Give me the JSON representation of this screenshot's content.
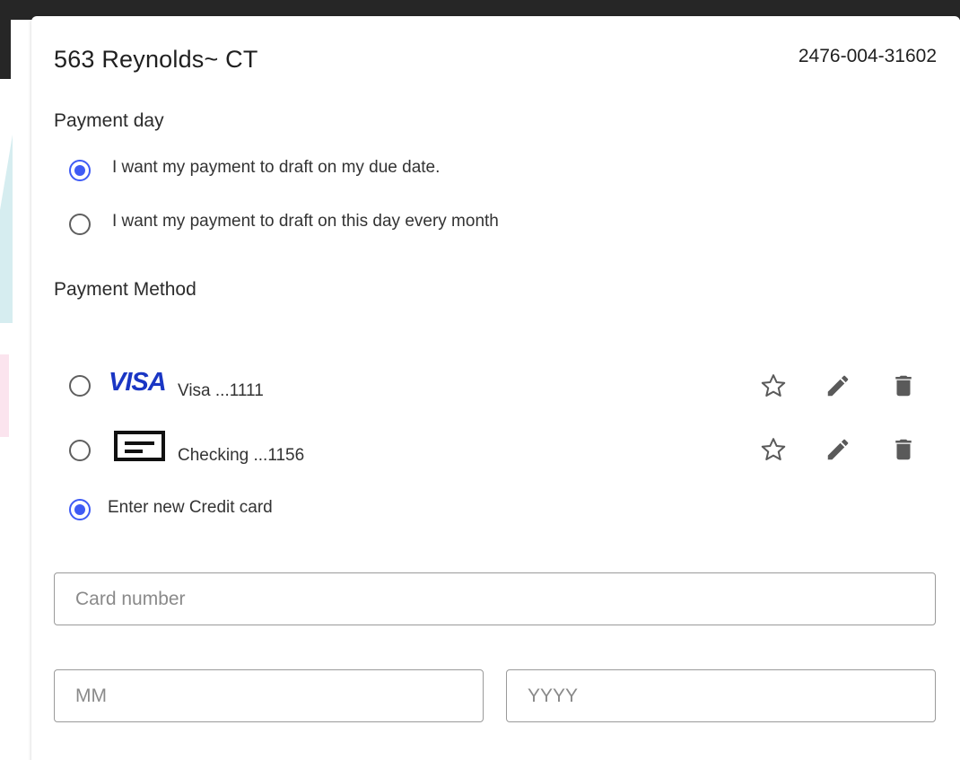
{
  "property": {
    "address": "563 Reynolds~ CT",
    "account_number": "2476-004-31602"
  },
  "payment_day": {
    "title": "Payment day",
    "options": [
      {
        "label": "I want my payment to draft on my due date.",
        "selected": true
      },
      {
        "label": "I want my payment to draft on this day every month",
        "selected": false
      }
    ]
  },
  "payment_method": {
    "title": "Payment Method",
    "methods": [
      {
        "brand_logo_text": "VISA",
        "label": "Visa ...1111",
        "icon": "visa-logo",
        "selected": false
      },
      {
        "label": "Checking ...1156",
        "icon": "bank-check-icon",
        "selected": false
      }
    ],
    "new_card_option": {
      "label": "Enter new Credit card",
      "selected": true
    },
    "action_icons": [
      "star-outline-icon",
      "pencil-edit-icon",
      "trash-delete-icon"
    ]
  },
  "new_card_form": {
    "card_number_placeholder": "Card number",
    "month_placeholder": "MM",
    "year_placeholder": "YYYY"
  },
  "colors": {
    "accent": "#3f5bf5",
    "visa_blue": "#1a36c4",
    "icon_gray": "#5a5a5a"
  }
}
